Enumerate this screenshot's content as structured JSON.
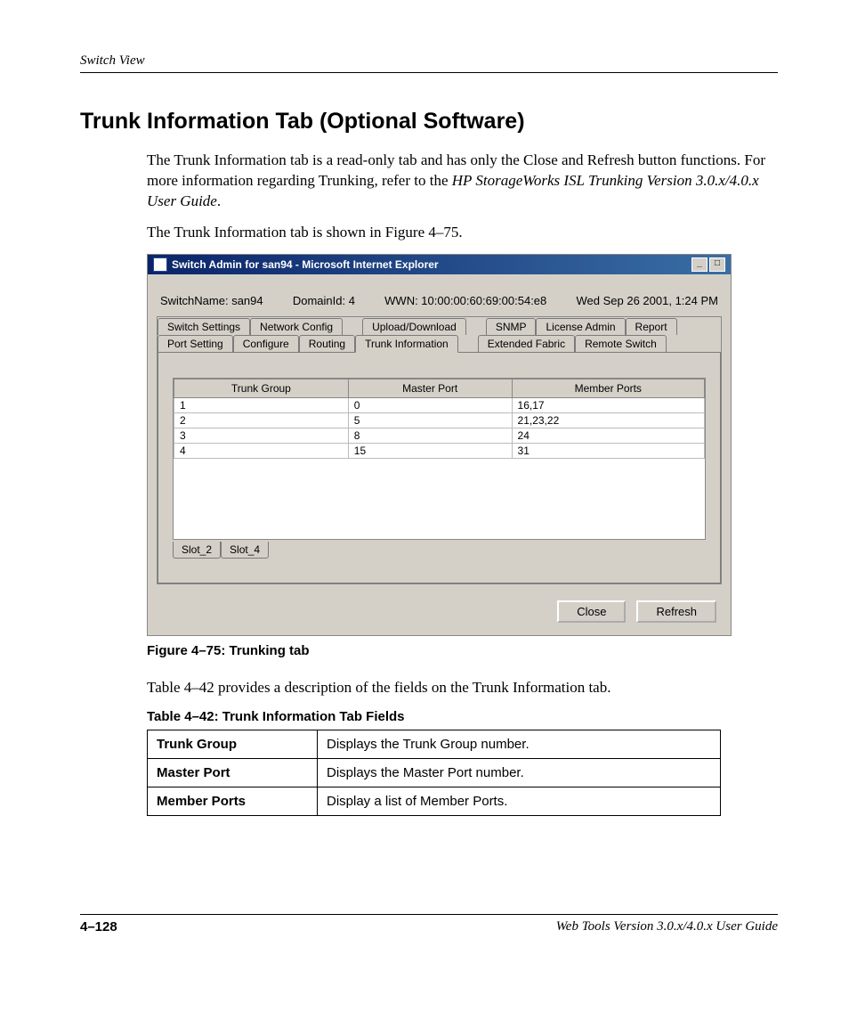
{
  "page": {
    "headerLeft": "Switch View",
    "sectionTitle": "Trunk Information Tab (Optional Software)",
    "para1a": "The Trunk Information tab is a read-only tab and has only the Close and Refresh button functions. For more information regarding Trunking, refer to the ",
    "para1b": "HP StorageWorks ISL Trunking Version 3.0.x/4.0.x User Guide",
    "para1c": ".",
    "para2": "The Trunk Information tab is shown in Figure 4–75.",
    "figCaption": "Figure 4–75:  Trunking tab",
    "para3": "Table 4–42 provides a description of the fields on the Trunk Information tab.",
    "tableCaption": "Table 4–42:  Trunk Information Tab Fields",
    "footerPage": "4–128",
    "footerRight": "Web Tools Version 3.0.x/4.0.x User Guide"
  },
  "win": {
    "title": "Switch Admin for san94 - Microsoft Internet Explorer",
    "switchNameLabel": "SwitchName: san94",
    "domainLabel": "DomainId: 4",
    "wwnLabel": "WWN: 10:00:00:60:69:00:54:e8",
    "dateLabel": "Wed Sep 26  2001, 1:24 PM",
    "tabsRow1": [
      "Switch Settings",
      "Network Config",
      "Upload/Download",
      "SNMP",
      "License Admin",
      "Report"
    ],
    "tabsRow2": [
      "Port Setting",
      "Configure",
      "Routing",
      "Trunk Information",
      "Extended Fabric",
      "Remote Switch"
    ],
    "activeTab": "Trunk Information",
    "tableHeaders": [
      "Trunk Group",
      "Master Port",
      "Member Ports"
    ],
    "rows": [
      {
        "g": "1",
        "m": "0",
        "p": "16,17"
      },
      {
        "g": "2",
        "m": "5",
        "p": "21,23,22"
      },
      {
        "g": "3",
        "m": "8",
        "p": "24"
      },
      {
        "g": "4",
        "m": "15",
        "p": "31"
      }
    ],
    "slotTabs": [
      "Slot_2",
      "Slot_4"
    ],
    "closeBtn": "Close",
    "refreshBtn": "Refresh"
  },
  "fieldsTable": [
    {
      "h": "Trunk Group",
      "d": "Displays the Trunk Group number."
    },
    {
      "h": "Master Port",
      "d": "Displays the Master Port number."
    },
    {
      "h": "Member Ports",
      "d": "Display a list of Member Ports."
    }
  ],
  "chart_data": {
    "type": "table",
    "title": "Trunk Information",
    "columns": [
      "Trunk Group",
      "Master Port",
      "Member Ports"
    ],
    "rows": [
      [
        "1",
        "0",
        "16,17"
      ],
      [
        "2",
        "5",
        "21,23,22"
      ],
      [
        "3",
        "8",
        "24"
      ],
      [
        "4",
        "15",
        "31"
      ]
    ]
  }
}
